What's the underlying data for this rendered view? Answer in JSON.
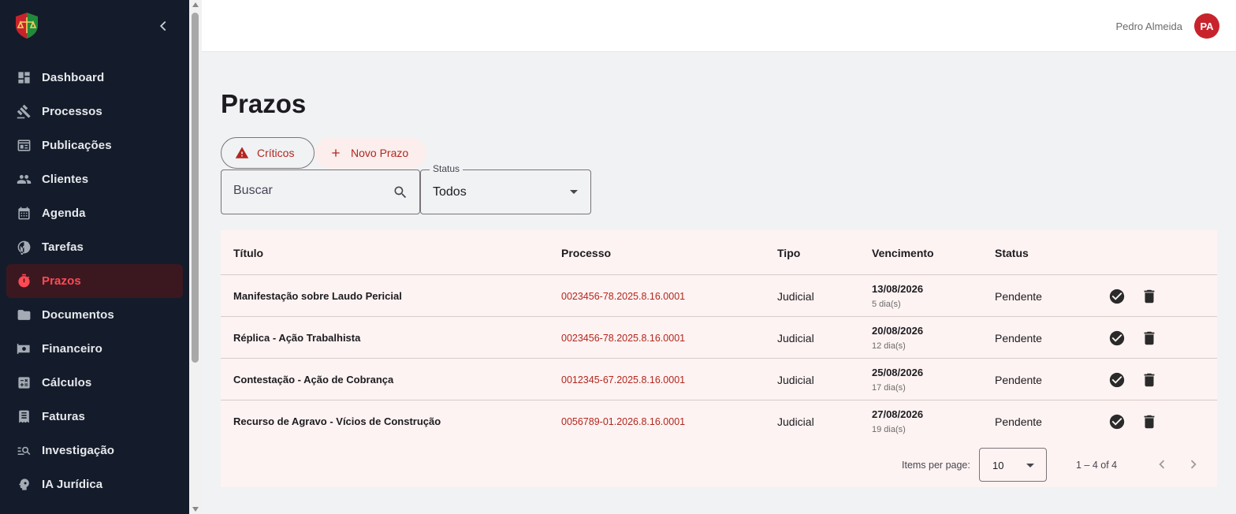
{
  "user": {
    "name": "Pedro Almeida",
    "initials": "PA"
  },
  "sidebar": {
    "items": [
      {
        "label": "Dashboard",
        "icon": "dashboard-icon"
      },
      {
        "label": "Processos",
        "icon": "gavel-icon"
      },
      {
        "label": "Publicações",
        "icon": "newspaper-icon"
      },
      {
        "label": "Clientes",
        "icon": "people-icon"
      },
      {
        "label": "Agenda",
        "icon": "calendar-icon"
      },
      {
        "label": "Tarefas",
        "icon": "task-check-icon"
      },
      {
        "label": "Prazos",
        "icon": "timer-icon",
        "active": true
      },
      {
        "label": "Documentos",
        "icon": "folder-icon"
      },
      {
        "label": "Financeiro",
        "icon": "money-icon"
      },
      {
        "label": "Cálculos",
        "icon": "calculator-icon"
      },
      {
        "label": "Faturas",
        "icon": "receipt-icon"
      },
      {
        "label": "Investigação",
        "icon": "manage-search-icon"
      },
      {
        "label": "IA Jurídica",
        "icon": "psychology-icon"
      }
    ]
  },
  "page": {
    "title": "Prazos"
  },
  "chips": {
    "criticos": "Críticos",
    "novo_prazo": "Novo Prazo"
  },
  "filters": {
    "search_placeholder": "Buscar",
    "status_label": "Status",
    "status_value": "Todos"
  },
  "table": {
    "headers": [
      "Título",
      "Processo",
      "Tipo",
      "Vencimento",
      "Status"
    ],
    "rows": [
      {
        "titulo": "Manifestação sobre Laudo Pericial",
        "processo": "0023456-78.2025.8.16.0001",
        "tipo": "Judicial",
        "vencimento": "13/08/2026",
        "dias": "5 dia(s)",
        "status": "Pendente"
      },
      {
        "titulo": "Réplica - Ação Trabalhista",
        "processo": "0023456-78.2025.8.16.0001",
        "tipo": "Judicial",
        "vencimento": "20/08/2026",
        "dias": "12 dia(s)",
        "status": "Pendente"
      },
      {
        "titulo": "Contestação - Ação de Cobrança",
        "processo": "0012345-67.2025.8.16.0001",
        "tipo": "Judicial",
        "vencimento": "25/08/2026",
        "dias": "17 dia(s)",
        "status": "Pendente"
      },
      {
        "titulo": "Recurso de Agravo - Vícios de Construção",
        "processo": "0056789-01.2026.8.16.0001",
        "tipo": "Judicial",
        "vencimento": "27/08/2026",
        "dias": "19 dia(s)",
        "status": "Pendente"
      }
    ]
  },
  "paginator": {
    "items_per_page_label": "Items per page:",
    "items_per_page": "10",
    "range": "1 – 4 of 4"
  },
  "colors": {
    "accent": "#b3261e",
    "sidebar_bg": "#141c2b",
    "active_item": "#ff4a55",
    "avatar": "#c8232c"
  }
}
